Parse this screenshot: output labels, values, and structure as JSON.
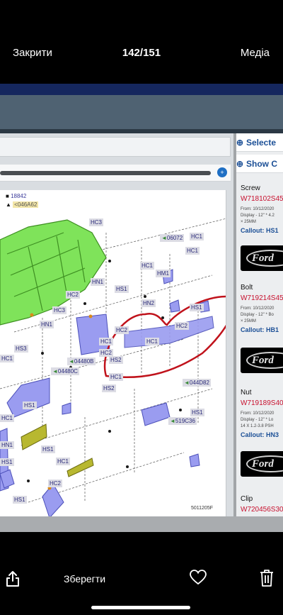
{
  "header": {
    "close_label": "Закрити",
    "counter": "142/151",
    "media_label": "Медіа"
  },
  "diagram": {
    "legend": [
      {
        "marker": "■",
        "value": "18842"
      },
      {
        "marker": "▲",
        "value": "<046A62"
      }
    ],
    "callouts": [
      "HC3",
      "HC2",
      "HC1",
      "HS1",
      "HN1",
      "HC1",
      "HM1",
      "HN2",
      "HS1",
      "HC2",
      "HC1",
      "HC3",
      "HN1",
      "HC2",
      "HC2",
      "HC1",
      "HS2",
      "HC1",
      "HC1",
      "HS3",
      "HS1",
      "HC1",
      "HS1",
      "HS1",
      "HN1",
      "HC1",
      "HC2",
      "HS1",
      "HS1",
      "HC1",
      "HS2"
    ],
    "ref_codes": [
      "06072",
      "04480B",
      "04480C",
      "044D82",
      "519C36"
    ],
    "figure_id": "5011205F"
  },
  "side_panel": {
    "links": [
      "Selecte",
      "Show C"
    ],
    "parts": [
      {
        "name": "Screw",
        "number": "W718102S45",
        "from": "From: 10/12/2020",
        "display": "Display - 12\" * 4.2",
        "extra": "× 25MM",
        "callout": "Callout: HS1"
      },
      {
        "name": "Bolt",
        "number": "W719214S45",
        "from": "From: 10/12/2020",
        "display": "Display - 12\" * Bo",
        "extra": "× 25MM",
        "callout": "Callout: HB1"
      },
      {
        "name": "Nut",
        "number": "W719189S40",
        "from": "From: 10/12/2020",
        "display": "Display - 12\" * Lo",
        "extra": "14 X 1.2-3.8 PSH",
        "callout": "Callout: HN3"
      },
      {
        "name": "Clip",
        "number": "W720456S30",
        "from": "",
        "display": "",
        "extra": "",
        "callout": ""
      }
    ],
    "logo_text": "Ford"
  },
  "footer": {
    "save_label": "Зберегти",
    "icons": [
      "share-icon",
      "heart-icon",
      "trash-icon"
    ]
  },
  "colors": {
    "background": "#000000",
    "navy_bar": "#15275e",
    "part_number": "#c8102e",
    "link_blue": "#1b4f96",
    "annotation_red": "#c0121b",
    "green_part": "#5cd13a",
    "blue_part": "#8a8ce6"
  }
}
